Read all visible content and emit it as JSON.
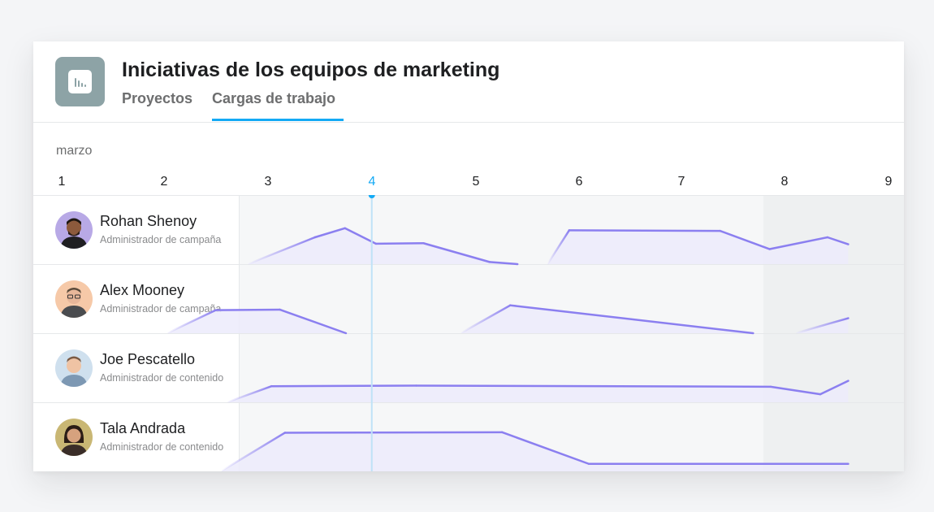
{
  "header": {
    "app_icon": "bar-chart-icon",
    "title": "Iniciativas de los equipos de marketing",
    "tabs": [
      {
        "label": "Proyectos",
        "active": false
      },
      {
        "label": "Cargas de trabajo",
        "active": true
      }
    ]
  },
  "timeline": {
    "month": "marzo",
    "days": [
      "1",
      "2",
      "3",
      "4",
      "5",
      "6",
      "7",
      "8",
      "9"
    ],
    "current_day": "4"
  },
  "people": [
    {
      "name": "Rohan Shenoy",
      "role": "Administrador de campaña"
    },
    {
      "name": "Alex Mooney",
      "role": "Administrador de campaña"
    },
    {
      "name": "Joe Pescatello",
      "role": "Administrador de contenido"
    },
    {
      "name": "Tala Andrada",
      "role": "Administrador de contenido"
    }
  ],
  "colors": {
    "accent": "#14aaf5",
    "workload_line": "#8b7ff0",
    "workload_fill": "#ecebfb",
    "app_icon_bg": "#8da3a6"
  },
  "workload": [
    [
      [
        2.8,
        0
      ],
      [
        3.45,
        0.5
      ],
      [
        3.74,
        0.67
      ],
      [
        4.04,
        0.38
      ],
      [
        4.5,
        0.39
      ],
      [
        5.14,
        0.04
      ],
      [
        5.41,
        0
      ],
      [
        5.7,
        0
      ],
      [
        5.91,
        0.63
      ],
      [
        7.37,
        0.62
      ],
      [
        7.85,
        0.28
      ],
      [
        8.41,
        0.5
      ],
      [
        8.61,
        0.37
      ]
    ],
    [
      [
        2.02,
        0
      ],
      [
        2.49,
        0.43
      ],
      [
        3.11,
        0.44
      ],
      [
        3.75,
        0
      ],
      [
        4.5,
        0
      ],
      [
        4.86,
        0
      ],
      [
        5.34,
        0.52
      ],
      [
        7.69,
        0
      ],
      [
        8.1,
        0
      ],
      [
        8.61,
        0.28
      ]
    ],
    [
      [
        2.6,
        0
      ],
      [
        3.03,
        0.3
      ],
      [
        4.43,
        0.31
      ],
      [
        7.86,
        0.29
      ],
      [
        8.34,
        0.15
      ],
      [
        8.61,
        0.4
      ]
    ],
    [
      [
        2.54,
        0
      ],
      [
        3.16,
        0.72
      ],
      [
        5.26,
        0.73
      ],
      [
        6.1,
        0.14
      ],
      [
        8.61,
        0.14
      ]
    ]
  ]
}
